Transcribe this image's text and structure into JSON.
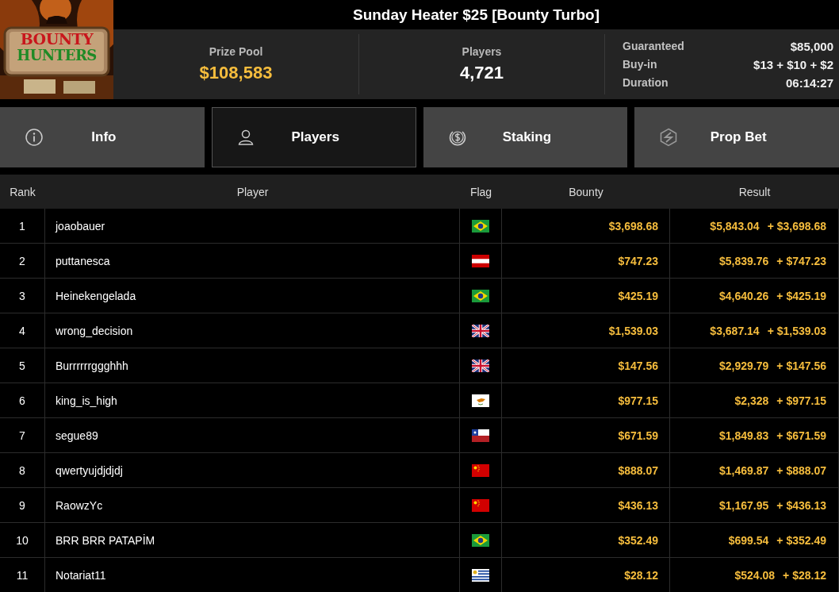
{
  "logo": {
    "line_1": "BOUNTY",
    "line_2": "HUNTERS"
  },
  "title": "Sunday Heater $25 [Bounty Turbo]",
  "stats": [
    {
      "label": "Prize Pool",
      "value": "$108,583",
      "highlight": true
    },
    {
      "label": "Players",
      "value": "4,721",
      "highlight": false
    }
  ],
  "details": [
    {
      "label": "Guaranteed",
      "value": "$85,000"
    },
    {
      "label": "Buy-in",
      "value": "$13 + $10 + $2"
    },
    {
      "label": "Duration",
      "value": "06:14:27"
    }
  ],
  "tabs": [
    {
      "label": "Info",
      "selected": false
    },
    {
      "label": "Players",
      "selected": true
    },
    {
      "label": "Staking",
      "selected": false
    },
    {
      "label": "Prop Bet",
      "selected": false
    }
  ],
  "table": {
    "columns": [
      "Rank",
      "Player",
      "Flag",
      "Bounty",
      "Result"
    ],
    "rows": [
      {
        "rank": "1",
        "player": "joaobauer",
        "kind": "br",
        "bounty": "$3,698.68",
        "result": "$5,843.04",
        "bonus": "+ $3,698.68"
      },
      {
        "rank": "2",
        "player": "puttanesca",
        "kind": "at",
        "bounty": "$747.23",
        "result": "$5,839.76",
        "bonus": "+ $747.23"
      },
      {
        "rank": "3",
        "player": "Heinekengelada",
        "kind": "br",
        "bounty": "$425.19",
        "result": "$4,640.26",
        "bonus": "+ $425.19"
      },
      {
        "rank": "4",
        "player": "wrong_decision",
        "kind": "gb",
        "bounty": "$1,539.03",
        "result": "$3,687.14",
        "bonus": "+ $1,539.03"
      },
      {
        "rank": "5",
        "player": "Burrrrrrggghhh",
        "kind": "gb",
        "bounty": "$147.56",
        "result": "$2,929.79",
        "bonus": "+ $147.56"
      },
      {
        "rank": "6",
        "player": "king_is_high",
        "kind": "cy",
        "bounty": "$977.15",
        "result": "$2,328",
        "bonus": "+ $977.15"
      },
      {
        "rank": "7",
        "player": "segue89",
        "kind": "cl",
        "bounty": "$671.59",
        "result": "$1,849.83",
        "bonus": "+ $671.59"
      },
      {
        "rank": "8",
        "player": "qwertyujdjdjdj",
        "kind": "cn",
        "bounty": "$888.07",
        "result": "$1,469.87",
        "bonus": "+ $888.07"
      },
      {
        "rank": "9",
        "player": "RaowzYc",
        "kind": "cn",
        "bounty": "$436.13",
        "result": "$1,167.95",
        "bonus": "+ $436.13"
      },
      {
        "rank": "10",
        "player": "BRR BRR PATAPİM",
        "kind": "br",
        "bounty": "$352.49",
        "result": "$699.54",
        "bonus": "+ $352.49"
      },
      {
        "rank": "11",
        "player": "Notariat11",
        "kind": "uy",
        "bounty": "$28.12",
        "result": "$524.08",
        "bonus": "+ $28.12"
      }
    ]
  }
}
